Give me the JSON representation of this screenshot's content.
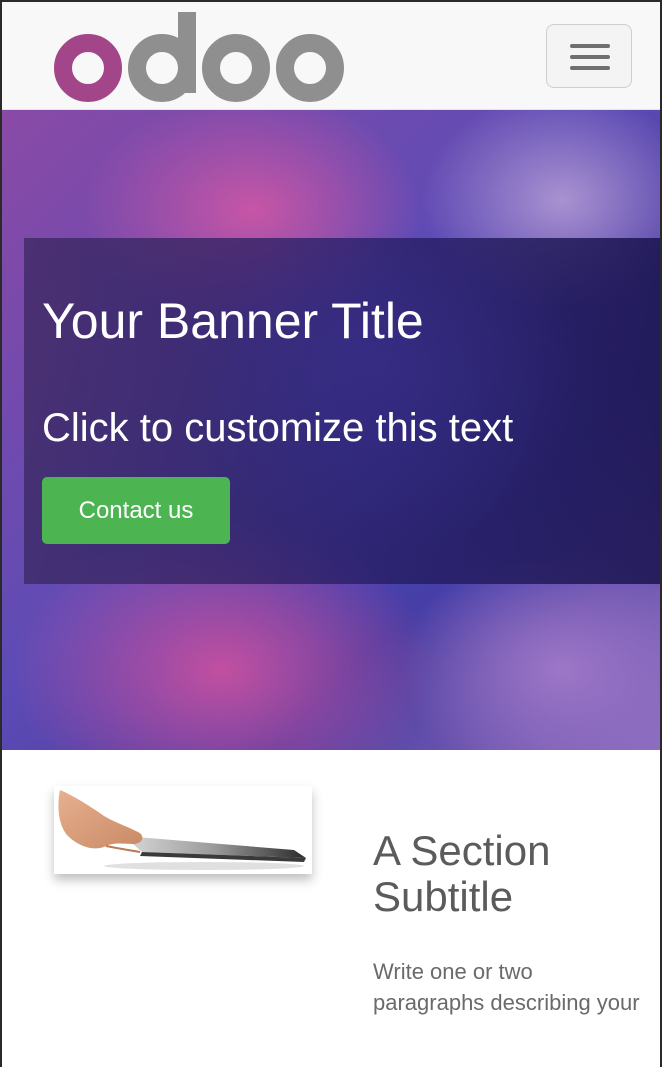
{
  "header": {
    "logo_text": "odoo",
    "menu_toggle_label": "Toggle navigation"
  },
  "banner": {
    "title": "Your Banner Title",
    "text": "Click to customize this text",
    "button_label": "Contact us"
  },
  "section": {
    "subtitle": "A Section Subtitle",
    "paragraph": "Write one or two paragraphs describing your"
  },
  "colors": {
    "logo_primary": "#a24689",
    "logo_secondary": "#8f8f8f",
    "button_green": "#4cb552",
    "subtitle_text": "#5b5b5b"
  },
  "icons": {
    "menu": "hamburger-icon",
    "section_image": "tablet-in-hand-image"
  }
}
